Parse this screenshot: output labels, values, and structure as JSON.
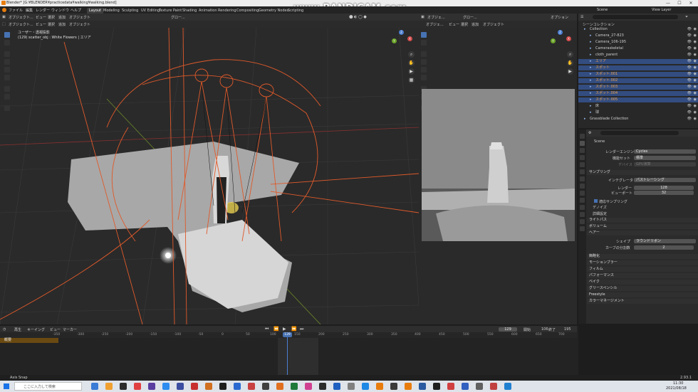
{
  "title_bar": {
    "title": "Blender* [G:¥BLENDER¥practicedata¥walking¥walking.blend]",
    "min": "—",
    "max": "☐",
    "close": "✕"
  },
  "watermark": "www.BANDICAM.com",
  "menu": [
    "ファイル",
    "編集",
    "レンダー",
    "ウィンドウ",
    "ヘルプ"
  ],
  "workspaces": [
    "Layout",
    "Modeling",
    "Sculpting",
    "UV Editing",
    "Texture Paint",
    "Shading",
    "Animation",
    "Rendering",
    "Compositing",
    "Geometry Nodes",
    "Scripting"
  ],
  "active_workspace": "Layout",
  "top_right": {
    "options": "オプション",
    "scene": "Scene",
    "view_layer": "View Layer"
  },
  "viewport_left": {
    "header": {
      "mode": "オブジェクト...",
      "view": "ビュー",
      "select": "選択",
      "add": "追加",
      "object": "オブジェクト",
      "global": "グロー..."
    },
    "overlay_title": "ユーザー・透視投影",
    "overlay_sub": "(129) scatter_obj : White Flowers | エリア"
  },
  "viewport_right": {
    "header": {
      "mode": "オブジェ...",
      "view": "ビュー",
      "select": "選択",
      "add": "追加",
      "object": "オブジェクト",
      "global": "グロー...",
      "options": "オプション"
    }
  },
  "gizmo": {
    "x": "X",
    "y": "Y",
    "z": "Z"
  },
  "outliner": {
    "header": "シーンコレクション",
    "rows": [
      {
        "label": "Collection",
        "indent": 1,
        "sel": false,
        "color": "#cfcfcf"
      },
      {
        "label": "Camera_27-823",
        "indent": 2,
        "sel": false,
        "color": "#cfcfcf"
      },
      {
        "label": "Camera_106-195",
        "indent": 2,
        "sel": false,
        "color": "#cfcfcf"
      },
      {
        "label": "Cameraskeletal",
        "indent": 2,
        "sel": false,
        "color": "#cfcfcf"
      },
      {
        "label": "cloth_parent",
        "indent": 2,
        "sel": false,
        "color": "#cfcfcf"
      },
      {
        "label": "エリア",
        "indent": 2,
        "sel": true,
        "color": "#e8a050"
      },
      {
        "label": "スポット",
        "indent": 2,
        "sel": true,
        "color": "#e8a050"
      },
      {
        "label": "スポット.001",
        "indent": 2,
        "sel": true,
        "color": "#e8a050"
      },
      {
        "label": "スポット.002",
        "indent": 2,
        "sel": true,
        "color": "#e8a050"
      },
      {
        "label": "スポット.003",
        "indent": 2,
        "sel": true,
        "color": "#e8a050"
      },
      {
        "label": "スポット.004",
        "indent": 2,
        "sel": true,
        "color": "#e8a050"
      },
      {
        "label": "スポット.005",
        "indent": 2,
        "sel": true,
        "color": "#e8a050"
      },
      {
        "label": "床",
        "indent": 2,
        "sel": false,
        "color": "#cfcfcf"
      },
      {
        "label": "球",
        "indent": 2,
        "sel": false,
        "color": "#cfcfcf"
      },
      {
        "label": "Grassblade Collection",
        "indent": 1,
        "sel": false,
        "color": "#cfcfcf"
      }
    ]
  },
  "properties": {
    "scene": "Scene",
    "render_engine_label": "レンダーエンジン",
    "render_engine": "Cycles",
    "feature_set_label": "機能セット",
    "feature_set": "標準",
    "device_label": "デバイス",
    "device": "GPU演算",
    "sampling": "サンプリング",
    "integrator_label": "インテグレータ",
    "integrator": "パストレーシング",
    "render_label": "レンダー",
    "render_val": "128",
    "viewport_label": "ビューポート",
    "viewport_val": "32",
    "adaptive": "適応サンプリング",
    "denoise": "デノイズ",
    "advanced": "詳細設定",
    "light_paths": "ライトパス",
    "volume": "ボリューム",
    "hair": "ヘアー",
    "shape_label": "シェイプ",
    "shape": "ラウンドリボン",
    "curve_label": "カーブの分割数",
    "curve_val": "2",
    "sections": [
      "簡略化",
      "モーションブラー",
      "フィルム",
      "パフォーマンス",
      "ベイク",
      "グリースペンシル",
      "Freestyle",
      "カラーマネージメント"
    ]
  },
  "timeline": {
    "header": {
      "playback": "再生",
      "keying": "キーイング",
      "view": "ビュー",
      "marker": "マーカー"
    },
    "current_frame": "129",
    "start_label": "開始",
    "start": "106",
    "end_label": "終了",
    "end": "195",
    "summary": "概要",
    "ticks": [
      "-350",
      "-300",
      "-250",
      "-200",
      "-150",
      "-100",
      "-50",
      "0",
      "50",
      "100",
      "129",
      "150",
      "200",
      "250",
      "300",
      "350",
      "400",
      "450",
      "500",
      "550",
      "600",
      "650",
      "700"
    ]
  },
  "status": {
    "left": "Axis Snap",
    "version": "2.93.1"
  },
  "taskbar": {
    "search": "ここに入力して検索",
    "time": "11:30",
    "date": "2021/08/18"
  }
}
